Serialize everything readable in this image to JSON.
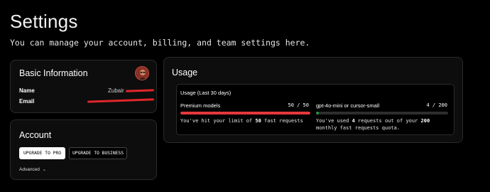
{
  "page": {
    "title": "Settings",
    "subtitle": "You can manage your account, billing, and team settings here."
  },
  "basic_info": {
    "title": "Basic Information",
    "name_label": "Name",
    "name_value": "Zubair",
    "email_label": "Email"
  },
  "account": {
    "title": "Account",
    "upgrade_pro_label": "UPGRADE TO PRO",
    "upgrade_business_label": "UPGRADE TO BUSINESS",
    "advanced_label": "Advanced"
  },
  "usage": {
    "title": "Usage",
    "period_label": "Usage (Last 30 days)",
    "premium": {
      "name": "Premium models",
      "count": "50 / 50",
      "used": 50,
      "limit": 50,
      "note_prefix": "You've hit your limit of",
      "note_value": "50",
      "note_suffix": "fast requests",
      "bar_color": "#e5383b"
    },
    "small": {
      "name": "gpt-4o-mini or cursor-small",
      "count": "4 / 200",
      "used": 4,
      "limit": 200,
      "note_prefix": "You've used",
      "note_value_1": "4",
      "note_middle": "requests out of your",
      "note_value_2": "200",
      "note_suffix": "monthly fast requests quota.",
      "bar_color": "#2f8f46"
    }
  },
  "colors": {
    "redaction": "#e0262b",
    "card_border": "#2b2b2b"
  }
}
